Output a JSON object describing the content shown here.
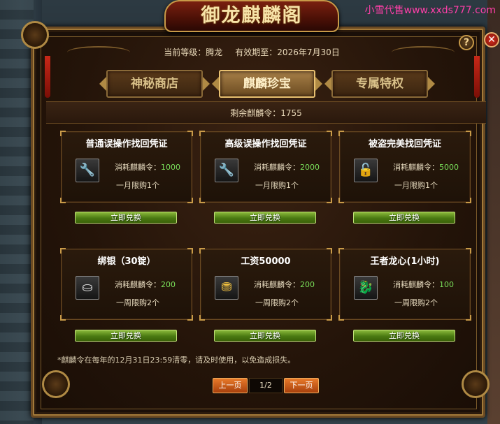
{
  "watermark": "小雪代售www.xxds777.com",
  "window": {
    "title": "御龙麒麟阁",
    "help_label": "?",
    "close_label": "✕"
  },
  "info": {
    "level_label": "当前等级：",
    "level_value": "腾龙",
    "expiry_label": "有效期至：",
    "expiry_value": "2026年7月30日"
  },
  "tabs": [
    {
      "label": "神秘商店",
      "active": false
    },
    {
      "label": "麒麟珍宝",
      "active": true
    },
    {
      "label": "专属特权",
      "active": false
    }
  ],
  "remaining": {
    "label": "剩余麒麟令：",
    "value": "1755"
  },
  "items": [
    {
      "title": "普通误操作找回凭证",
      "icon": "wrench-icon",
      "glyph": "🔧",
      "cost_label": "消耗麒麟令：",
      "cost": "1000",
      "limit": "一月限购1个",
      "button": "立即兑换"
    },
    {
      "title": "高级误操作找回凭证",
      "icon": "wrench-icon",
      "glyph": "🔧",
      "cost_label": "消耗麒麟令：",
      "cost": "2000",
      "limit": "一月限购1个",
      "button": "立即兑换"
    },
    {
      "title": "被盗完美找回凭证",
      "icon": "treasure-chest-icon",
      "glyph": "🔓",
      "cost_label": "消耗麒麟令：",
      "cost": "5000",
      "limit": "一月限购1个",
      "button": "立即兑换"
    },
    {
      "title": "绑银（30锭）",
      "icon": "silver-ingot-icon",
      "glyph": "⛀",
      "cost_label": "消耗麒麟令：",
      "cost": "200",
      "limit": "一周限购2个",
      "button": "立即兑换"
    },
    {
      "title": "工资50000",
      "icon": "gold-coins-icon",
      "glyph": "⛃",
      "cost_label": "消耗麒麟令：",
      "cost": "200",
      "limit": "一周限购2个",
      "button": "立即兑换"
    },
    {
      "title": "王者龙心(1小时)",
      "icon": "dragon-heart-icon",
      "glyph": "🐉",
      "cost_label": "消耗麒麟令：",
      "cost": "100",
      "limit": "一周限购2个",
      "button": "立即兑换"
    }
  ],
  "note": "*麒麟令在每年的12月31日23:59清零，请及时使用，以免造成损失。",
  "pagination": {
    "prev_label": "上一页",
    "page": "1/2",
    "next_label": "下一页"
  },
  "colors": {
    "accent_gold": "#c89a48",
    "cost_green": "#7adf5a",
    "button_green": "#4a7a12",
    "pager_orange": "#d0601a",
    "watermark_pink": "#ff3fa8"
  }
}
